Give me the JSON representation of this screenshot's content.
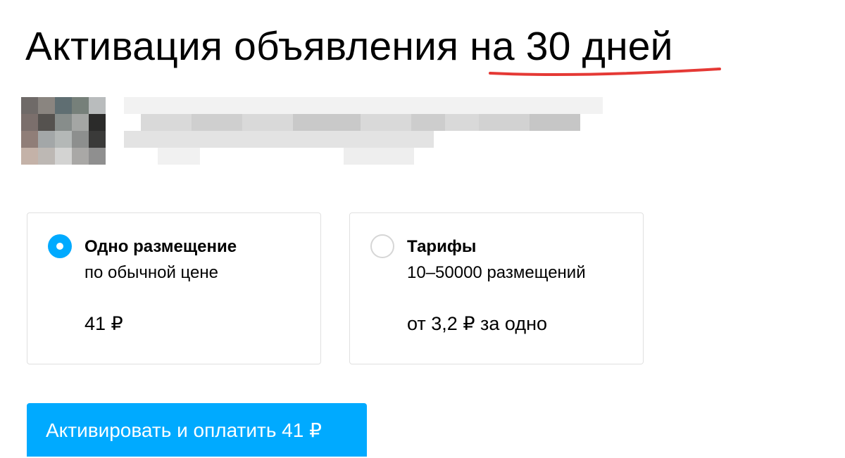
{
  "page": {
    "title": "Активация объявления на 30 дней"
  },
  "options": [
    {
      "title": "Одно размещение",
      "subtitle": "по обычной цене",
      "price": "41 ₽",
      "selected": true
    },
    {
      "title": "Тарифы",
      "subtitle": "10–50000 размещений",
      "price": "от 3,2 ₽ за одно",
      "selected": false
    }
  ],
  "actions": {
    "pay_button_label": "Активировать и оплатить 41 ₽"
  },
  "colors": {
    "accent": "#00aaff",
    "underline": "#e53935",
    "card_border": "#e0e0e0",
    "radio_border": "#d6d6d6"
  }
}
